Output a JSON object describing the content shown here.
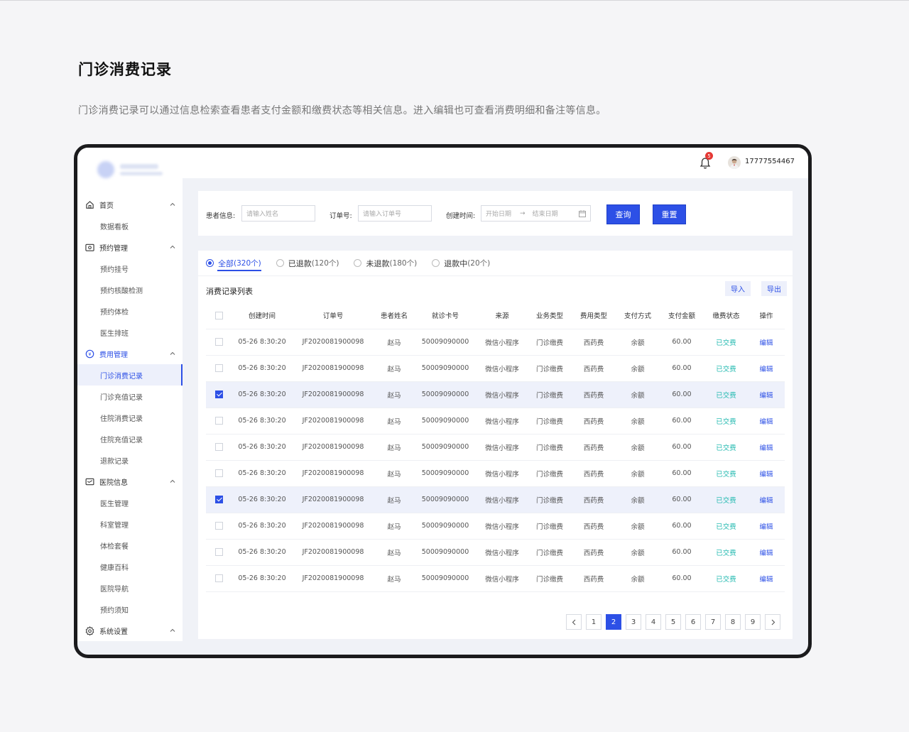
{
  "page": {
    "title": "门诊消费记录",
    "description": "门诊消费记录可以通过信息检索查看患者支付金额和缴费状态等相关信息。进入编辑也可查看消费明细和备注等信息。"
  },
  "header": {
    "notification_count": "5",
    "username": "17777554467"
  },
  "sidebar": {
    "groups": [
      {
        "label": "首页",
        "icon": "home-icon",
        "items": [
          "数据看板"
        ]
      },
      {
        "label": "预约管理",
        "icon": "calendar-icon",
        "items": [
          "预约挂号",
          "预约核酸检测",
          "预约体检",
          "医生排班"
        ]
      },
      {
        "label": "费用管理",
        "icon": "fee-icon",
        "items": [
          "门诊消费记录",
          "门诊充值记录",
          "住院消费记录",
          "住院充值记录",
          "退款记录"
        ]
      },
      {
        "label": "医院信息",
        "icon": "hospital-icon",
        "items": [
          "医生管理",
          "科室管理",
          "体检套餐",
          "健康百科",
          "医院导航",
          "预约须知"
        ]
      },
      {
        "label": "系统设置",
        "icon": "settings-icon",
        "items": []
      }
    ],
    "active_item": "门诊消费记录"
  },
  "filters": {
    "patient_label": "患者信息:",
    "patient_placeholder": "请输入姓名",
    "order_label": "订单号:",
    "order_placeholder": "请输入订单号",
    "time_label": "创建时间:",
    "start_placeholder": "开始日期",
    "end_placeholder": "结束日期",
    "query_button": "查询",
    "reset_button": "重置"
  },
  "tabs": [
    {
      "label": "全部",
      "count": "(320个)",
      "active": true
    },
    {
      "label": "已退款",
      "count": "(120个)",
      "active": false
    },
    {
      "label": "未退款",
      "count": "(180个)",
      "active": false
    },
    {
      "label": "退款中",
      "count": "(20个)",
      "active": false
    }
  ],
  "list": {
    "title": "消费记录列表",
    "import_button": "导入",
    "export_button": "导出",
    "columns": [
      "创建时间",
      "订单号",
      "患者姓名",
      "就诊卡号",
      "来源",
      "业务类型",
      "费用类型",
      "支付方式",
      "支付金额",
      "缴费状态",
      "操作"
    ],
    "rows": [
      {
        "selected": false,
        "cells": [
          "05-26 8:30:20",
          "JF2020081900098",
          "赵马",
          "50009090000",
          "微信小程序",
          "门诊缴费",
          "西药费",
          "余额",
          "60.00",
          "已交费",
          "编辑"
        ]
      },
      {
        "selected": false,
        "cells": [
          "05-26 8:30:20",
          "JF2020081900098",
          "赵马",
          "50009090000",
          "微信小程序",
          "门诊缴费",
          "西药费",
          "余额",
          "60.00",
          "已交费",
          "编辑"
        ]
      },
      {
        "selected": true,
        "cells": [
          "05-26 8:30:20",
          "JF2020081900098",
          "赵马",
          "50009090000",
          "微信小程序",
          "门诊缴费",
          "西药费",
          "余额",
          "60.00",
          "已交费",
          "编辑"
        ]
      },
      {
        "selected": false,
        "cells": [
          "05-26 8:30:20",
          "JF2020081900098",
          "赵马",
          "50009090000",
          "微信小程序",
          "门诊缴费",
          "西药费",
          "余额",
          "60.00",
          "已交费",
          "编辑"
        ]
      },
      {
        "selected": false,
        "cells": [
          "05-26 8:30:20",
          "JF2020081900098",
          "赵马",
          "50009090000",
          "微信小程序",
          "门诊缴费",
          "西药费",
          "余额",
          "60.00",
          "已交费",
          "编辑"
        ]
      },
      {
        "selected": false,
        "cells": [
          "05-26 8:30:20",
          "JF2020081900098",
          "赵马",
          "50009090000",
          "微信小程序",
          "门诊缴费",
          "西药费",
          "余额",
          "60.00",
          "已交费",
          "编辑"
        ]
      },
      {
        "selected": true,
        "cells": [
          "05-26 8:30:20",
          "JF2020081900098",
          "赵马",
          "50009090000",
          "微信小程序",
          "门诊缴费",
          "西药费",
          "余额",
          "60.00",
          "已交费",
          "编辑"
        ]
      },
      {
        "selected": false,
        "cells": [
          "05-26 8:30:20",
          "JF2020081900098",
          "赵马",
          "50009090000",
          "微信小程序",
          "门诊缴费",
          "西药费",
          "余额",
          "60.00",
          "已交费",
          "编辑"
        ]
      },
      {
        "selected": false,
        "cells": [
          "05-26 8:30:20",
          "JF2020081900098",
          "赵马",
          "50009090000",
          "微信小程序",
          "门诊缴费",
          "西药费",
          "余额",
          "60.00",
          "已交费",
          "编辑"
        ]
      },
      {
        "selected": false,
        "cells": [
          "05-26 8:30:20",
          "JF2020081900098",
          "赵马",
          "50009090000",
          "微信小程序",
          "门诊缴费",
          "西药费",
          "余额",
          "60.00",
          "已交费",
          "编辑"
        ]
      }
    ]
  },
  "pagination": {
    "pages": [
      "1",
      "2",
      "3",
      "4",
      "5",
      "6",
      "7",
      "8",
      "9"
    ],
    "current": "2"
  },
  "colors": {
    "accent": "#2d50e6",
    "status_paid": "#2bbcb3",
    "selected_row": "#eef1fb"
  }
}
